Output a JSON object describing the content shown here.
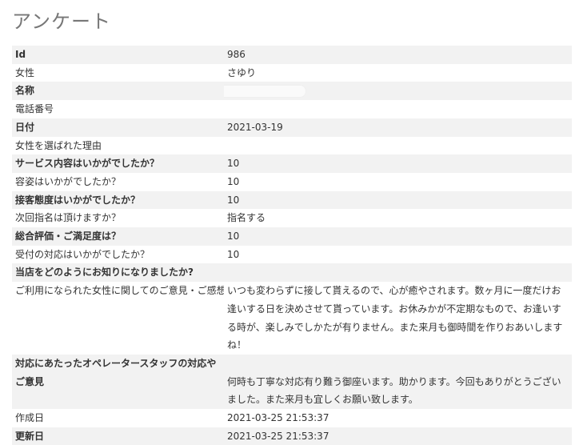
{
  "page": {
    "title": "アンケート"
  },
  "rows": [
    {
      "label": "Id",
      "value": "986",
      "bold": true
    },
    {
      "label": "女性",
      "value": "さゆり",
      "bold": false
    },
    {
      "label": "名称",
      "value": "",
      "bold": true
    },
    {
      "label": "電話番号",
      "value": "",
      "bold": false
    },
    {
      "label": "日付",
      "value": "2021-03-19",
      "bold": true
    },
    {
      "label": "女性を選ばれた理由",
      "value": "",
      "bold": false
    },
    {
      "label": "サービス内容はいかがでしたか？",
      "value": "10",
      "bold": true
    },
    {
      "label": "容姿はいかがでしたか？",
      "value": "10",
      "bold": false
    },
    {
      "label": "接客態度はいかがでしたか？",
      "value": "10",
      "bold": true
    },
    {
      "label": "次回指名は頂けますか？",
      "value": "指名する",
      "bold": false
    },
    {
      "label": "総合評価・ご満足度は？",
      "value": "10",
      "bold": true
    },
    {
      "label": "受付の対応はいかがでしたか？",
      "value": "10",
      "bold": false
    },
    {
      "label": "当店をどのようにお知りになりましたか?",
      "value": "",
      "bold": true
    },
    {
      "label": "ご利用になられた女性に関してのご意見・ご感想",
      "value": "いつも変わらずに接して貰えるので、心が癒やされます。数ヶ月に一度だけお逢いする日を決めさせて貰っています。お休みかが不定期なもので、お逢いする時が、楽しみでしかたが有りません。また来月も御時間を作りおあいしますね！",
      "bold": false
    },
    {
      "label": "対応にあたったオペレータースタッフの対応やご意見",
      "value": "何時も丁寧な対応有り難う御座います。助かります。今回もありがとうございました。また来月も宜しくお願い致します。",
      "bold": true
    },
    {
      "label": "作成日",
      "value": "2021-03-25 21:53:37",
      "bold": false
    },
    {
      "label": "更新日",
      "value": "2021-03-25 21:53:37",
      "bold": true
    }
  ]
}
